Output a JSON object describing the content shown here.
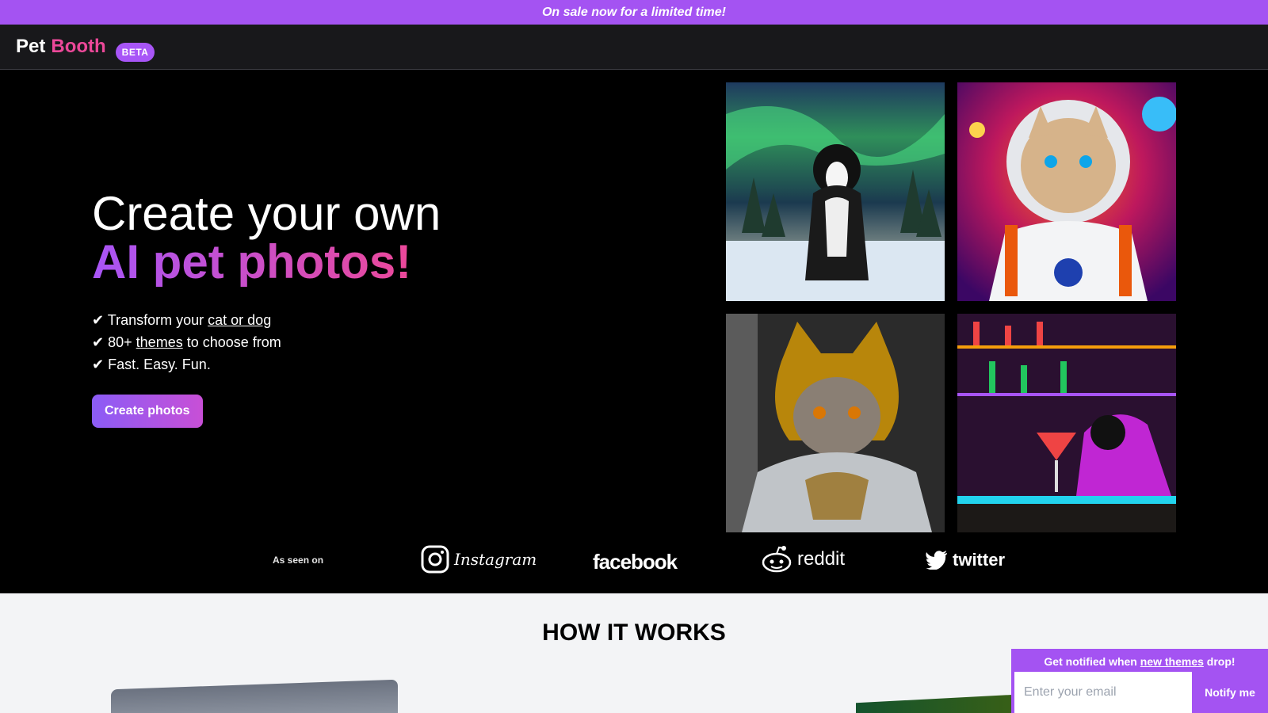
{
  "promo": {
    "text": "On sale now for a limited time!"
  },
  "nav": {
    "brand_pet": "Pet",
    "brand_booth": "Booth",
    "badge": "BETA"
  },
  "hero": {
    "heading_line1": "Create your own",
    "heading_line2": "AI pet photos!",
    "features": [
      {
        "check": "✔",
        "before": "Transform your",
        "link": "cat or dog",
        "after": ""
      },
      {
        "check": "✔",
        "before": "80+",
        "link": "themes",
        "after": "to choose from"
      },
      {
        "check": "✔",
        "before": "Fast. Easy. Fun.",
        "link": "",
        "after": ""
      }
    ],
    "cta_label": "Create photos",
    "images": [
      {
        "icon": "dog-aurora-image"
      },
      {
        "icon": "cat-astronaut-image"
      },
      {
        "icon": "cat-knight-image"
      },
      {
        "icon": "dog-bar-image"
      }
    ]
  },
  "seen_on": {
    "label": "As seen on",
    "logos": [
      "Instagram",
      "facebook",
      "reddit",
      "twitter"
    ]
  },
  "how": {
    "title": "HOW IT WORKS"
  },
  "notify": {
    "title_before": "Get notified when",
    "title_link": "new themes",
    "title_after": "drop!",
    "placeholder": "Enter your email",
    "button_label": "Notify me"
  },
  "colors": {
    "accent": "#a453f2",
    "pink": "#ec4899",
    "nav_bg": "#18181b"
  }
}
